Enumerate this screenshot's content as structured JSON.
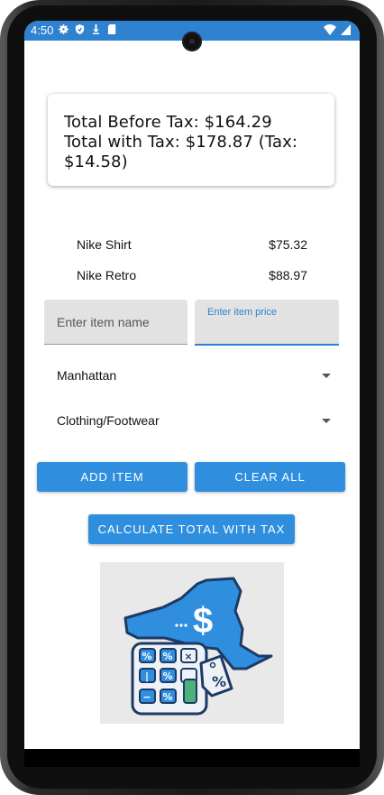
{
  "status_bar": {
    "time": "4:50"
  },
  "summary": {
    "line1": "Total Before Tax: $164.29",
    "line2": "Total with Tax: $178.87 (Tax:",
    "line3": "$14.58)"
  },
  "items": [
    {
      "name": "Nike Shirt",
      "price": "$75.32"
    },
    {
      "name": "Nike Retro",
      "price": "$88.97"
    }
  ],
  "inputs": {
    "item_name_placeholder": "Enter item name",
    "item_price_label": "Enter item price"
  },
  "selects": {
    "location": "Manhattan",
    "category": "Clothing/Footwear"
  },
  "buttons": {
    "add_item": "ADD ITEM",
    "clear_all": "CLEAR ALL",
    "calculate": "CALCULATE TOTAL WITH TAX"
  },
  "colors": {
    "accent": "#2f8fde",
    "status_bar": "#2f82d0"
  },
  "icons": {
    "illustration": "ny-tax-calculator-illustration"
  }
}
